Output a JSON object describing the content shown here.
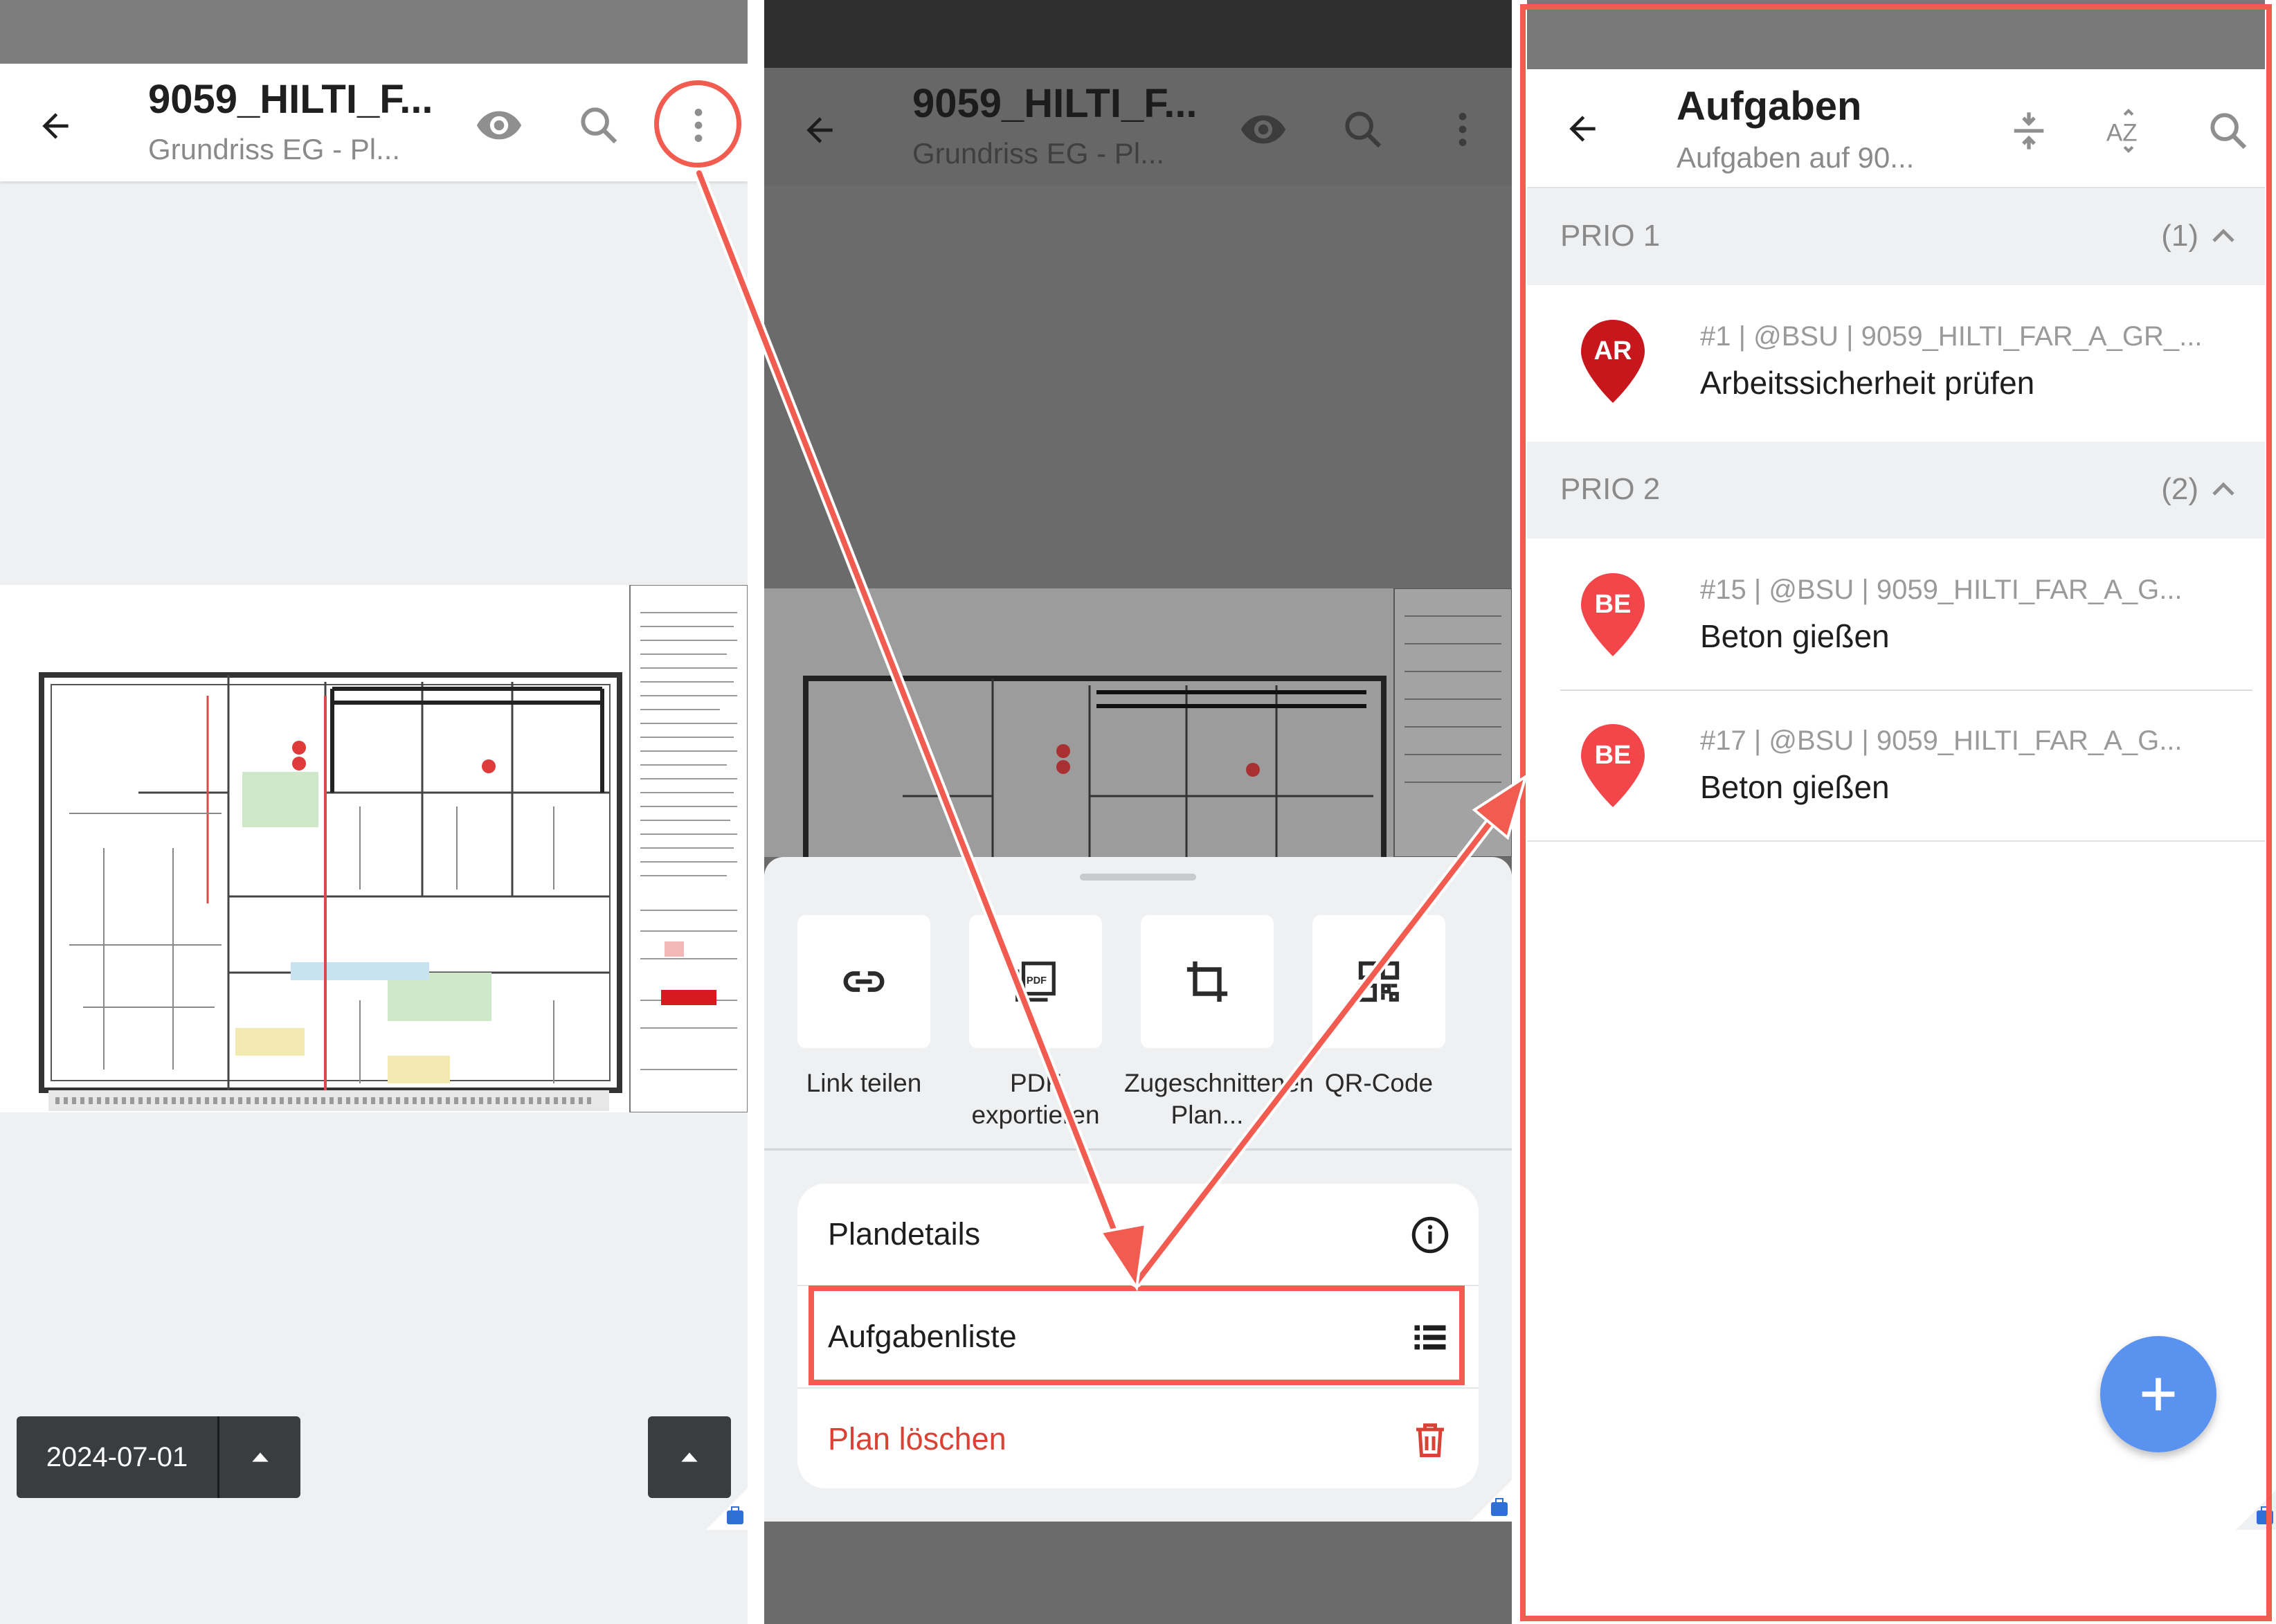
{
  "plan_view": {
    "title": "9059_HILTI_F...",
    "subtitle": "Grundriss EG - Pl...",
    "date": "2024-07-01",
    "icons": [
      "back-arrow-icon",
      "eye-icon",
      "search-icon",
      "more-vert-icon"
    ]
  },
  "menu_sheet": {
    "title": "9059_HILTI_F...",
    "subtitle": "Grundriss EG - Pl...",
    "actions": [
      {
        "label": "Link teilen",
        "icon": "link-icon"
      },
      {
        "label": "PDF exportieren",
        "icon": "pdf-icon"
      },
      {
        "label": "Zugeschnittenen Plan...",
        "icon": "crop-icon"
      },
      {
        "label": "QR-Code",
        "icon": "qr-code-icon"
      }
    ],
    "items": [
      {
        "label": "Plandetails",
        "icon": "info-icon"
      },
      {
        "label": "Aufgabenliste",
        "icon": "list-icon"
      },
      {
        "label": "Plan löschen",
        "icon": "trash-icon"
      }
    ]
  },
  "tasks_view": {
    "title": "Aufgaben",
    "subtitle": "Aufgaben auf 90...",
    "icons": [
      "back-arrow-icon",
      "collapse-icon",
      "sort-az-icon",
      "search-icon"
    ],
    "sections": [
      {
        "name": "PRIO 1",
        "count": "(1)",
        "tasks": [
          {
            "badge": "AR",
            "meta": "#1 | @BSU | 9059_HILTI_FAR_A_GR_...",
            "name": "Arbeitssicherheit prüfen",
            "color": "#c8161d"
          }
        ]
      },
      {
        "name": "PRIO 2",
        "count": "(2)",
        "tasks": [
          {
            "badge": "BE",
            "meta": "#15 | @BSU | 9059_HILTI_FAR_A_G...",
            "name": "Beton gießen",
            "color": "#f2464b"
          },
          {
            "badge": "BE",
            "meta": "#17 | @BSU | 9059_HILTI_FAR_A_G...",
            "name": "Beton gießen",
            "color": "#f2464b"
          }
        ]
      }
    ]
  },
  "colors": {
    "annotation": "#f25b50",
    "fab": "#5a93ef",
    "danger": "#d84335"
  }
}
